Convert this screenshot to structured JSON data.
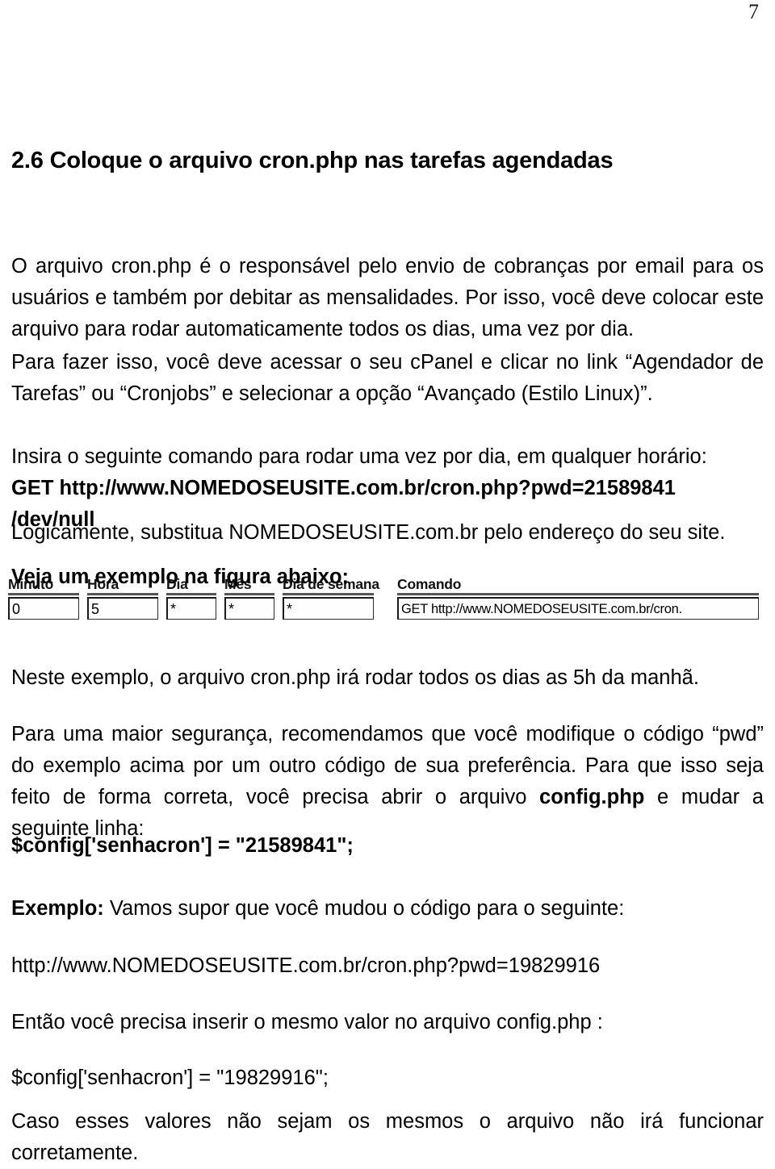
{
  "document": {
    "page_number": "7",
    "heading": "2.6 Coloque o arquivo cron.php nas tarefas agendadas",
    "paragraphs": {
      "p1": "O arquivo cron.php é o responsável pelo envio de cobranças por email para os usuários e também por debitar as mensalidades. Por isso, você deve colocar este arquivo para rodar automaticamente todos os dias, uma vez por dia.",
      "p2": "Para fazer isso, você deve acessar o seu cPanel e clicar no link “Agendador de Tarefas” ou “Cronjobs” e selecionar a opção “Avançado (Estilo Linux)”.",
      "p3": "Insira o seguinte comando para rodar uma vez por dia, em qualquer horário:",
      "p4": "GET http://www.NOMEDOSEUSITE.com.br/cron.php?pwd=21589841 /dev/null",
      "p5": "Logicamente, substitua NOMEDOSEUSITE.com.br pelo endereço do seu site.",
      "p6": "Veja um exemplo na figura abaixo:",
      "p7": "Neste exemplo, o arquivo cron.php irá rodar todos os dias as 5h da manhã.",
      "p8_part1": "Para uma maior segurança, recomendamos que você modifique o código “pwd” do exemplo acima por um outro código de sua preferência. Para que isso seja feito de forma correta, você precisa abrir o arquivo ",
      "p8_bold": "config.php",
      "p8_part2": " e mudar a seguinte linha:",
      "p9": "$config['senhacron'] = \"21589841\";",
      "p10_bold": "Exemplo:",
      "p10_rest": " Vamos supor que você mudou o código para o seguinte:",
      "p11": "http://www.NOMEDOSEUSITE.com.br/cron.php?pwd=19829916",
      "p12": "Então você precisa inserir o mesmo valor no arquivo config.php :",
      "p13": "$config['senhacron'] = \"19829916\";",
      "p14": "Caso esses valores não sejam os mesmos o arquivo não irá funcionar corretamente."
    }
  },
  "cron_figure": {
    "columns": [
      {
        "label": "Minuto",
        "value": "0"
      },
      {
        "label": "Hora",
        "value": "5"
      },
      {
        "label": "Dia",
        "value": "*"
      },
      {
        "label": "Mês",
        "value": "*"
      },
      {
        "label": "Dia de semana",
        "value": "*"
      },
      {
        "label": "Comando",
        "value": "GET http://www.NOMEDOSEUSITE.com.br/cron."
      }
    ]
  }
}
